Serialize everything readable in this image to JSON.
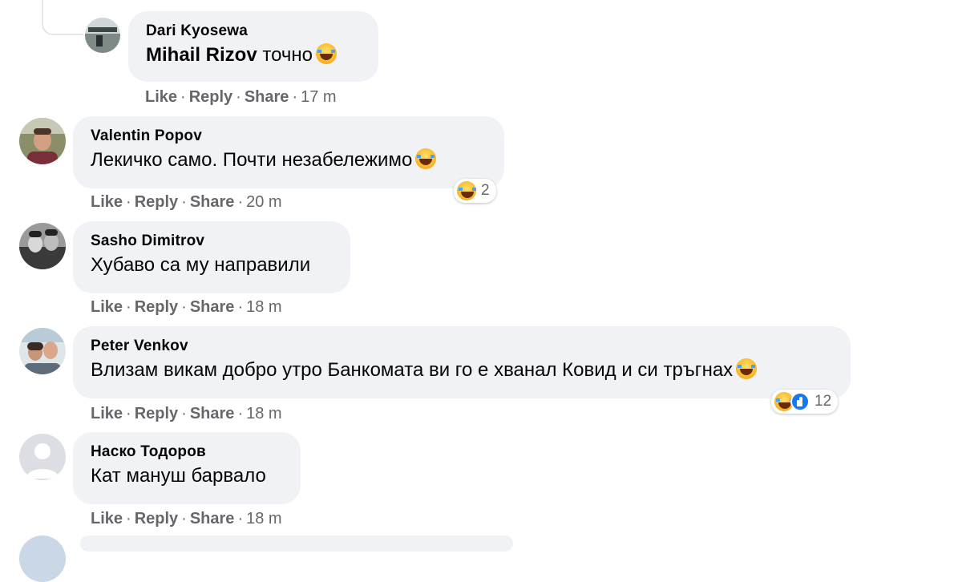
{
  "actions": {
    "like": "Like",
    "reply": "Reply",
    "share": "Share",
    "sep": "·"
  },
  "comments": [
    {
      "author": "Dari Kyosewa",
      "mention": "Mihail Rizov",
      "text": "точно",
      "time": "17 m",
      "avatar_icon": "user-photo-icon"
    },
    {
      "author": "Valentin Popov",
      "text": "Лекичко само. Почти незабележимо",
      "time": "20 m",
      "reactions": {
        "icons": [
          "haha-icon"
        ],
        "count": "2"
      }
    },
    {
      "author": "Sasho Dimitrov",
      "text": "Хубаво са му направили",
      "time": "18 m"
    },
    {
      "author": "Peter Venkov",
      "text": "Влизам викам добро утро Банкомата ви го е хванал Ковид и си тръгнах",
      "time": "18 m",
      "reactions": {
        "icons": [
          "haha-icon",
          "like-icon"
        ],
        "count": "12"
      }
    },
    {
      "author": "Наско Тодоров",
      "text": "Кат мануш барвало",
      "time": "18 m",
      "avatar_icon": "default-avatar-icon"
    }
  ],
  "colors": {
    "bubble": "#f0f2f5",
    "secondary_text": "#65676b",
    "like_blue": "#1877f2"
  }
}
